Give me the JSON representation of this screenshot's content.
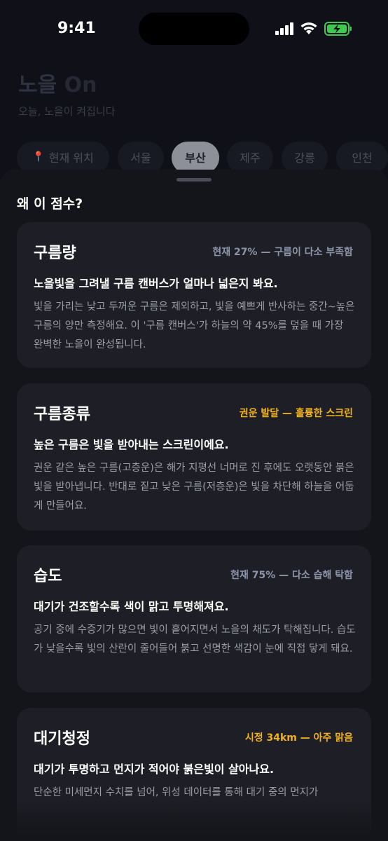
{
  "status_bar": {
    "time": "9:41"
  },
  "app": {
    "title_main": "노을",
    "title_accent": "On",
    "subtitle": "오늘, 노을이 켜집니다"
  },
  "city_tabs": [
    {
      "label": "현재 위치",
      "icon": "location-pin-icon"
    },
    {
      "label": "서울"
    },
    {
      "label": "부산",
      "active": true
    },
    {
      "label": "제주"
    },
    {
      "label": "강릉"
    },
    {
      "label": "인천"
    }
  ],
  "sheet": {
    "title": "왜 이 점수?",
    "cards": [
      {
        "title": "구름량",
        "status": "현재 27% — 구름이 다소 부족함",
        "status_color": "#8c95aa",
        "headline": "노을빛을 그려낼 구름 캔버스가 얼마나 넓은지 봐요.",
        "body": "빛을 가리는 낮고 두꺼운 구름은 제외하고, 빛을 예쁘게 반사하는 중간~높은 구름의 양만 측정해요. 이 '구름 캔버스'가 하늘의 약 45%를 덮을 때 가장 완벽한 노을이 완성됩니다."
      },
      {
        "title": "구름종류",
        "status": "권운 발달 — 훌륭한 스크린",
        "status_color": "#f2b21b",
        "headline": "높은 구름은 빛을 받아내는 스크린이에요.",
        "body": "권운 같은 높은 구름(고층운)은 해가 지평선 너머로 진 후에도 오랫동안 붉은빛을 받아냅니다. 반대로 짙고 낮은 구름(저층운)은 빛을 차단해 하늘을 어둡게 만들어요."
      },
      {
        "title": "습도",
        "status": "현재 75% — 다소 습해 탁함",
        "status_color": "#8c95aa",
        "headline": "대기가 건조할수록 색이 맑고 투명해져요.",
        "body": "공기 중에 수증기가 많으면 빛이 흩어지면서 노을의 채도가 탁해집니다. 습도가 낮을수록 빛의 산란이 줄어들어 붉고 선명한 색감이 눈에 직접 닿게 돼요."
      },
      {
        "title": "대기청정",
        "status": "시정 34km — 아주 맑음",
        "status_color": "#f2b21b",
        "headline": "대기가 투명하고 먼지가 적어야 붉은빛이 살아나요.",
        "body": "단순한 미세먼지 수치를 넘어, 위성 데이터를 통해 대기 중의 먼지가"
      }
    ]
  }
}
